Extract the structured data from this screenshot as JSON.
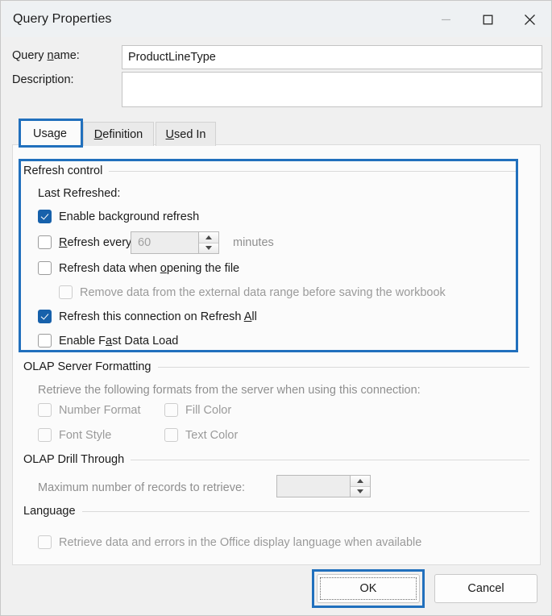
{
  "window": {
    "title": "Query Properties",
    "buttons": {
      "minimize": "minimize-icon",
      "maximize": "maximize-icon",
      "close": "close-icon"
    }
  },
  "form": {
    "query_name_label_pre": "Query ",
    "query_name_label_acc": "n",
    "query_name_label_post": "ame:",
    "query_name_value": "ProductLineType",
    "description_label": "Description:",
    "description_value": ""
  },
  "tabs": [
    {
      "id": "usage",
      "pre": "Usa",
      "acc": "g",
      "post": "e",
      "selected": true
    },
    {
      "id": "definition",
      "pre": "",
      "acc": "D",
      "post": "efinition",
      "selected": false
    },
    {
      "id": "used-in",
      "pre": "",
      "acc": "U",
      "post": "sed In",
      "selected": false
    }
  ],
  "refresh_control": {
    "group_title": "Refresh control",
    "last_refreshed_label": "Last Refreshed:",
    "enable_background_refresh": {
      "pre": "Enable back",
      "acc": "g",
      "post": "round refresh",
      "checked": true,
      "disabled": false
    },
    "refresh_every": {
      "pre": "",
      "acc": "R",
      "post": "efresh every",
      "checked": false,
      "disabled": false
    },
    "refresh_every_value": "60",
    "minutes_label": "minutes",
    "refresh_on_open": {
      "pre": "Refresh data when ",
      "acc": "o",
      "post": "pening the file",
      "checked": false,
      "disabled": false
    },
    "remove_data": {
      "pre": "Remove data from the external data range before saving the workbook",
      "acc": "",
      "post": "",
      "checked": false,
      "disabled": true
    },
    "refresh_all": {
      "pre": "Refresh this connection on Refresh ",
      "acc": "A",
      "post": "ll",
      "checked": true,
      "disabled": false
    },
    "fast_data_load": {
      "pre": "Enable F",
      "acc": "a",
      "post": "st Data Load",
      "checked": false,
      "disabled": false
    }
  },
  "olap_formatting": {
    "group_title": "OLAP Server Formatting",
    "description": "Retrieve the following formats from the server when using this connection:",
    "options": [
      {
        "label": "Number Format",
        "checked": false,
        "disabled": true
      },
      {
        "label": "Fill Color",
        "checked": false,
        "disabled": true
      },
      {
        "label": "Font Style",
        "checked": false,
        "disabled": true
      },
      {
        "label": "Text Color",
        "checked": false,
        "disabled": true
      }
    ]
  },
  "olap_drill_through": {
    "group_title": "OLAP Drill Through",
    "max_records_label": "Maximum number of records to retrieve:",
    "max_records_value": ""
  },
  "language": {
    "group_title": "Language",
    "option": {
      "label": "Retrieve data and errors in the Office display language when available",
      "checked": false,
      "disabled": true
    }
  },
  "footer": {
    "ok_label": "OK",
    "cancel_label": "Cancel"
  },
  "annotations": {
    "color": "#2170bd",
    "targets": [
      "usage-tab",
      "refresh-control-group",
      "ok-button"
    ]
  }
}
